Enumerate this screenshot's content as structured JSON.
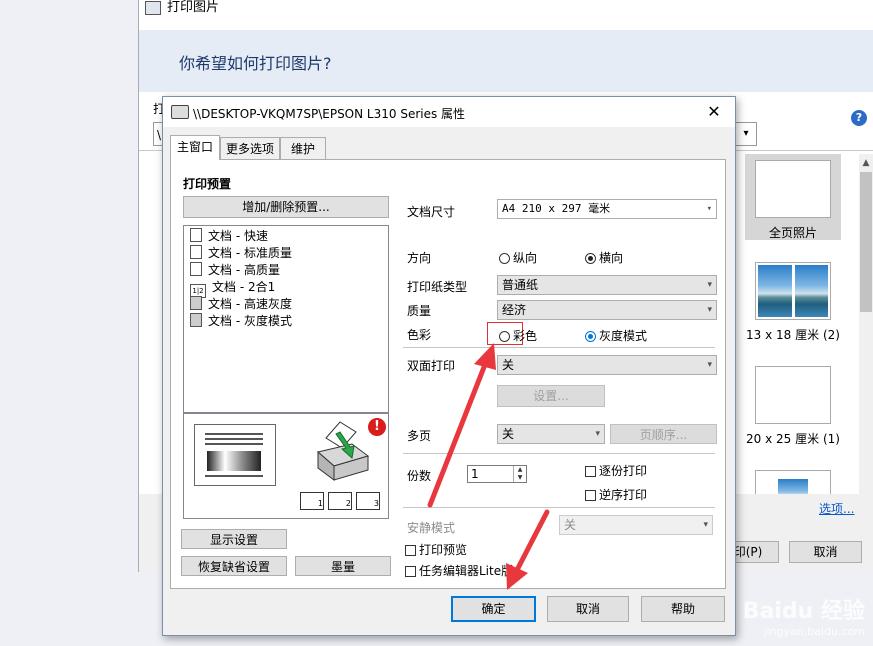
{
  "background_window": {
    "title": "打印图片",
    "question": "你希望如何打印图片?",
    "printer_label": "打",
    "printer_value": "\\",
    "help_icon_text": "?",
    "layouts": [
      {
        "label": "全页照片",
        "selected": true
      },
      {
        "label": "13 x 18 厘米 (2)",
        "selected": false
      },
      {
        "label": "20 x 25 厘米 (1)",
        "selected": false
      },
      {
        "label": "",
        "selected": false
      }
    ],
    "options_link": "选项...",
    "print_button": "印(P)",
    "cancel_button": "取消"
  },
  "dialog": {
    "title": "\\\\DESKTOP-VKQM7SP\\EPSON L310 Series 属性",
    "close_glyph": "✕",
    "tabs": [
      "主窗口",
      "更多选项",
      "维护"
    ],
    "active_tab": 0,
    "presets": {
      "section_title": "打印预置",
      "add_delete_button": "增加/删除预置...",
      "items": [
        {
          "label": "文档 - 快速",
          "icon": "document-icon",
          "glyph": ""
        },
        {
          "label": "文档 - 标准质量",
          "icon": "document-icon",
          "glyph": ""
        },
        {
          "label": "文档 - 高质量",
          "icon": "document-icon",
          "glyph": ""
        },
        {
          "label": "文档 - 2合1",
          "icon": "two-up-icon",
          "glyph": "1|2"
        },
        {
          "label": "文档 - 高速灰度",
          "icon": "document-gray-icon",
          "glyph": ""
        },
        {
          "label": "文档 - 灰度模式",
          "icon": "document-gray-icon",
          "glyph": ""
        }
      ]
    },
    "preview": {
      "warning_glyph": "!",
      "tray_numbers": [
        "1",
        "2",
        "3"
      ]
    },
    "settings": {
      "doc_size_label": "文档尺寸",
      "doc_size_value": "A4 210 x 297 毫米",
      "orientation_label": "方向",
      "orientation_portrait": "纵向",
      "orientation_landscape": "横向",
      "orientation_selected": "landscape",
      "paper_type_label": "打印纸类型",
      "paper_type_value": "普通纸",
      "quality_label": "质量",
      "quality_value": "经济",
      "color_label": "色彩",
      "color_option": "彩色",
      "grayscale_option": "灰度模式",
      "color_selected": "grayscale",
      "duplex_label": "双面打印",
      "duplex_value": "关",
      "duplex_settings_button": "设置...",
      "multipage_label": "多页",
      "multipage_value": "关",
      "page_order_button": "页顺序...",
      "copies_label": "份数",
      "copies_value": "1",
      "collate_label": "逐份打印",
      "reverse_label": "逆序打印",
      "quiet_mode_label": "安静模式",
      "quiet_mode_value": "关",
      "print_preview_label": "打印预览",
      "job_arranger_label": "任务编辑器Lite版"
    },
    "left_buttons": {
      "show_settings": "显示设置",
      "restore_defaults": "恢复缺省设置",
      "ink_levels": "墨量"
    },
    "footer": {
      "ok": "确定",
      "cancel": "取消",
      "help": "帮助"
    }
  },
  "annotation_color": "#e8383d",
  "watermark": {
    "brand": "Baidu 经验",
    "url": "jingyan.baidu.com"
  }
}
